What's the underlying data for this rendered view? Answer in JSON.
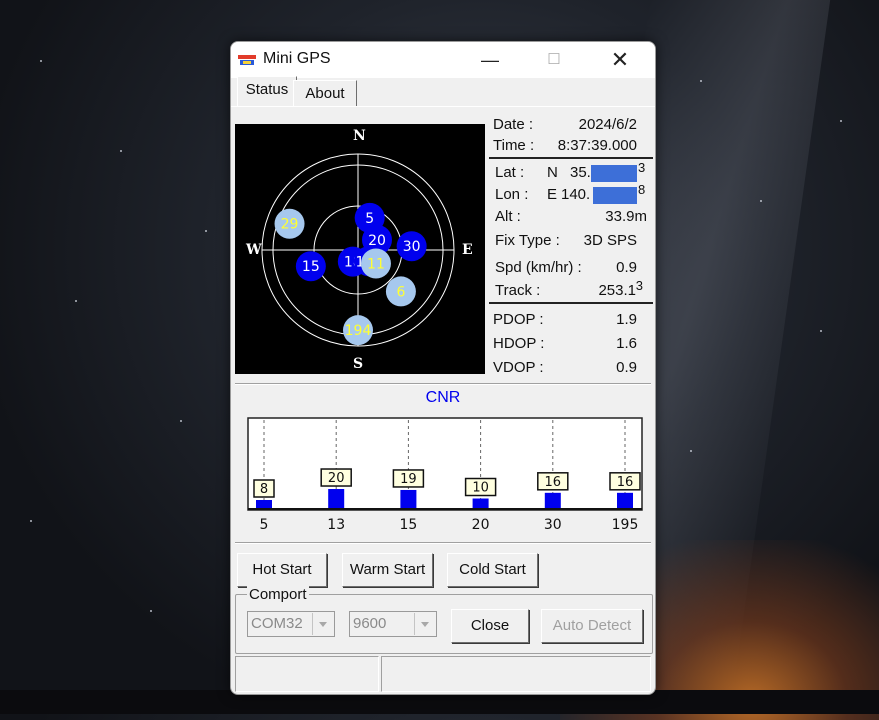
{
  "window": {
    "title": "Mini GPS"
  },
  "tabs": [
    {
      "label": "Status"
    },
    {
      "label": "About"
    }
  ],
  "sky": {
    "compass": {
      "n": "N",
      "s": "S",
      "e": "E",
      "w": "W"
    },
    "satellites": [
      {
        "prn": "5",
        "type": "used",
        "az": 20,
        "el": 55
      },
      {
        "prn": "20",
        "type": "used",
        "az": 62,
        "el": 68
      },
      {
        "prn": "30",
        "type": "used",
        "az": 86,
        "el": 35
      },
      {
        "prn": "29",
        "type": "visible",
        "az": 291,
        "el": 15
      },
      {
        "prn": "15",
        "type": "used",
        "az": 251,
        "el": 39
      },
      {
        "prn": "18",
        "type": "used",
        "az": 204,
        "el": 77
      },
      {
        "prn": "195",
        "type": "used",
        "az": 136,
        "el": 74
      },
      {
        "prn": "11",
        "type": "visible",
        "az": 127,
        "el": 67
      },
      {
        "prn": "6",
        "type": "visible",
        "az": 134,
        "el": 29
      },
      {
        "prn": "194",
        "type": "visible",
        "az": 180,
        "el": 8
      }
    ],
    "colors": {
      "used": "#0000ee",
      "visible": "#a6c8ee",
      "used_text": "#ffffff",
      "visible_text": "#ffff33"
    }
  },
  "info": {
    "date_label": "Date :",
    "date_value": "2024/6/2",
    "time_label": "Time :",
    "time_value": "8:37:39.000",
    "lat_label": "Lat :",
    "lat_hemi": "N",
    "lat_value": "35.",
    "lat_tail": "3",
    "lon_label": "Lon :",
    "lon_hemi": "E",
    "lon_value": "140.",
    "lon_tail": "8",
    "alt_label": "Alt :",
    "alt_value": "33.9m",
    "fix_label": "Fix Type :",
    "fix_value": "3D SPS",
    "spd_label": "Spd (km/hr) :",
    "spd_value": "0.9",
    "track_label": "Track :",
    "track_value": "253.1",
    "track_tail": "3",
    "pdop_label": "PDOP :",
    "pdop_value": "1.9",
    "hdop_label": "HDOP :",
    "hdop_value": "1.6",
    "vdop_label": "VDOP :",
    "vdop_value": "0.9"
  },
  "cnr": {
    "title": "CNR"
  },
  "chart_data": {
    "type": "bar",
    "title": "CNR",
    "categories": [
      "5",
      "13",
      "15",
      "20",
      "30",
      "195"
    ],
    "values": [
      8,
      20,
      19,
      10,
      16,
      16
    ],
    "ylim": [
      0,
      99
    ],
    "bar_color": "#0000ee"
  },
  "buttons": {
    "hot_start": "Hot Start",
    "warm_start": "Warm Start",
    "cold_start": "Cold Start",
    "close": "Close",
    "auto_detect": "Auto Detect"
  },
  "comport": {
    "group_label": "Comport",
    "port_value": "COM32",
    "baud_value": "9600"
  }
}
